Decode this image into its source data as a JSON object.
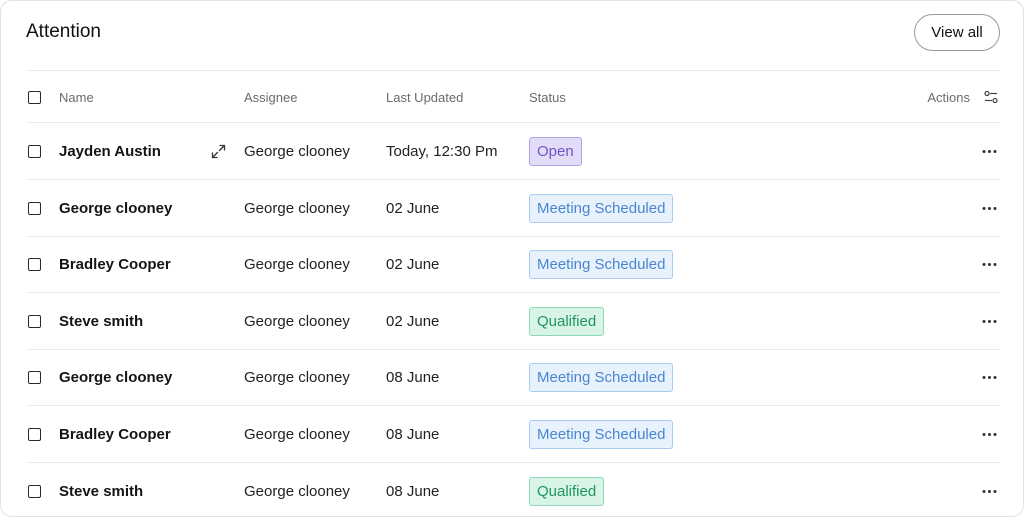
{
  "header": {
    "title": "Attention",
    "view_all_label": "View all"
  },
  "table": {
    "columns": {
      "name": "Name",
      "assignee": "Assignee",
      "last_updated": "Last Updated",
      "status": "Status",
      "actions": "Actions"
    },
    "rows": [
      {
        "name": "Jayden Austin",
        "assignee": "George clooney",
        "last_updated": "Today, 12:30 Pm",
        "status": "Open",
        "status_type": "open"
      },
      {
        "name": "George clooney",
        "assignee": "George clooney",
        "last_updated": "02 June",
        "status": "Meeting Scheduled",
        "status_type": "meeting"
      },
      {
        "name": "Bradley Cooper",
        "assignee": "George clooney",
        "last_updated": "02 June",
        "status": "Meeting Scheduled",
        "status_type": "meeting"
      },
      {
        "name": "Steve smith",
        "assignee": "George clooney",
        "last_updated": "02 June",
        "status": "Qualified",
        "status_type": "qualified"
      },
      {
        "name": "George clooney",
        "assignee": "George clooney",
        "last_updated": "08 June",
        "status": "Meeting Scheduled",
        "status_type": "meeting"
      },
      {
        "name": "Bradley Cooper",
        "assignee": "George clooney",
        "last_updated": "08 June",
        "status": "Meeting Scheduled",
        "status_type": "meeting"
      },
      {
        "name": "Steve smith",
        "assignee": "George clooney",
        "last_updated": "08 June",
        "status": "Qualified",
        "status_type": "qualified"
      }
    ]
  },
  "colors": {
    "open_bg": "#e2dcf8",
    "meeting_bg": "#e8f2fc",
    "qualified_bg": "#d7f4e7"
  },
  "icons": {
    "expand": "expand-icon",
    "filter": "filter-settings-icon",
    "more": "more-horizontal-icon"
  }
}
